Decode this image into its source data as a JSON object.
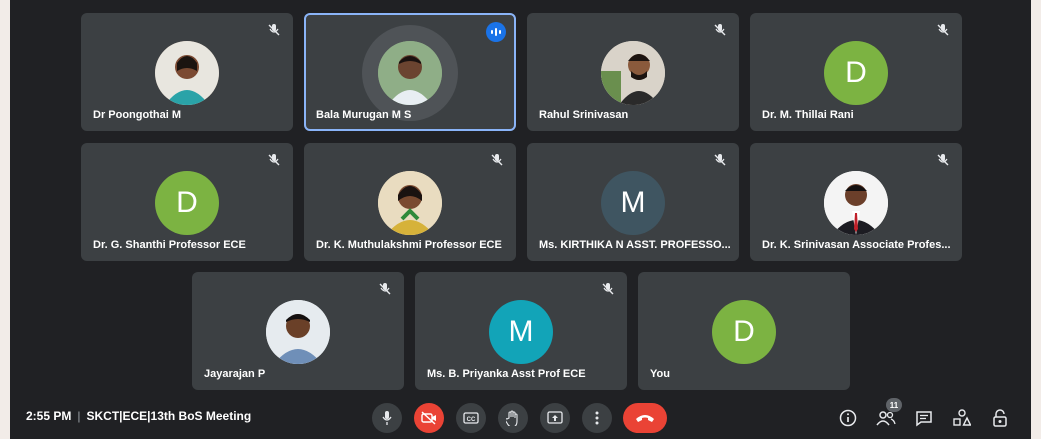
{
  "colors": {
    "tile_bg": "#3c4043",
    "stage_bg": "#202124",
    "active_border": "#8ab4f8",
    "green_avatar": "#7cb342",
    "slate_avatar": "#3f5561",
    "teal_avatar": "#12a4b8",
    "danger": "#ea4335"
  },
  "participants": [
    {
      "name": "Dr Poongothai M",
      "avatar": "photo"
    },
    {
      "name": "Bala Murugan M S",
      "avatar": "photo"
    },
    {
      "name": "Rahul Srinivasan",
      "avatar": "photo"
    },
    {
      "name": "Dr. M. Thillai Rani",
      "initial": "D"
    },
    {
      "name": "Dr. G. Shanthi Professor ECE",
      "initial": "D"
    },
    {
      "name": "Dr. K. Muthulakshmi Professor ECE",
      "avatar": "photo"
    },
    {
      "name": "Ms. KIRTHIKA N ASST. PROFESSO...",
      "initial": "M"
    },
    {
      "name": "Dr. K. Srinivasan Associate Profes...",
      "avatar": "photo"
    },
    {
      "name": "Jayarajan P",
      "avatar": "photo"
    },
    {
      "name": "Ms. B. Priyanka Asst Prof ECE",
      "initial": "M"
    },
    {
      "name": "You",
      "initial": "D"
    }
  ],
  "bottom_bar": {
    "time": "2:55 PM",
    "separator": "|",
    "meeting_title": "SKCT|ECE|13th BoS Meeting",
    "participant_count": "11",
    "controls": [
      "mic-icon",
      "camera-off-icon",
      "captions-icon",
      "raise-hand-icon",
      "present-icon",
      "more-options-icon",
      "hang-up-icon"
    ],
    "right_icons": [
      "info-icon",
      "people-icon",
      "chat-icon",
      "activities-icon",
      "host-controls-icon"
    ]
  }
}
